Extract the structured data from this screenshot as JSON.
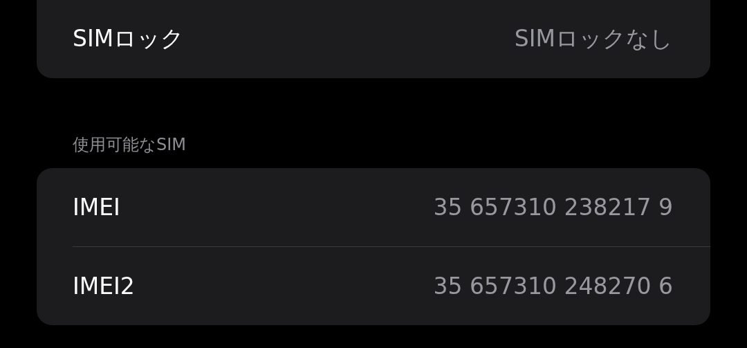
{
  "sections": [
    {
      "rows": [
        {
          "label": "SIMロック",
          "value": "SIMロックなし"
        }
      ]
    },
    {
      "header": "使用可能なSIM",
      "rows": [
        {
          "label": "IMEI",
          "value": "35 657310 238217 9"
        },
        {
          "label": "IMEI2",
          "value": "35 657310 248270 6"
        }
      ]
    }
  ]
}
